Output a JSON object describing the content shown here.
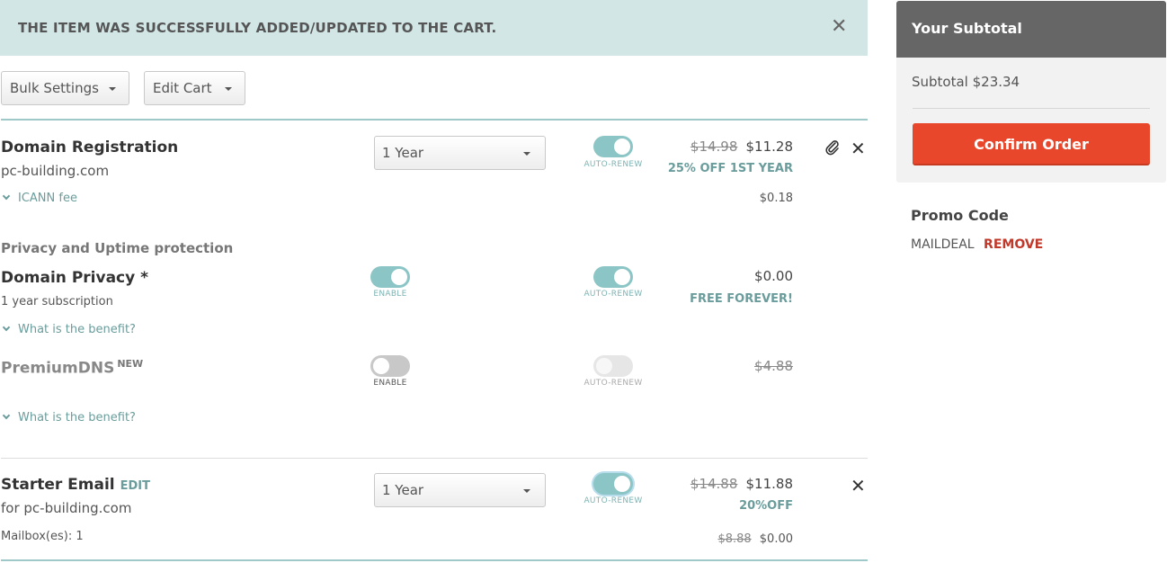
{
  "alert": {
    "message": "THE ITEM WAS SUCCESSFULLY ADDED/UPDATED TO THE CART.",
    "close": "✕"
  },
  "toolbar": {
    "bulk_settings": "Bulk Settings",
    "edit_cart": "Edit Cart"
  },
  "domain": {
    "title": "Domain Registration",
    "name": "pc-building.com",
    "period": "1 Year",
    "auto_renew": "AUTO-RENEW",
    "old_price": "$14.98",
    "price": "$11.28",
    "discount": "25% OFF 1ST YEAR",
    "icann_label": "ICANN fee",
    "icann_price": "$0.18"
  },
  "protection": {
    "heading": "Privacy and Uptime protection",
    "privacy": {
      "title": "Domain Privacy *",
      "subtitle": "1 year subscription",
      "enable": "ENABLE",
      "auto_renew": "AUTO-RENEW",
      "price": "$0.00",
      "note": "FREE FOREVER!",
      "benefit": "What is the benefit?"
    },
    "premiumdns": {
      "title": "PremiumDNS",
      "badge": "NEW",
      "enable": "ENABLE",
      "auto_renew": "AUTO-RENEW",
      "old_price": "$4.88",
      "benefit": "What is the benefit?"
    }
  },
  "email": {
    "title": "Starter Email",
    "edit": "EDIT",
    "for": "for pc-building.com",
    "period": "1 Year",
    "auto_renew": "AUTO-RENEW",
    "old_price": "$14.88",
    "price": "$11.88",
    "discount": "20%OFF",
    "mailboxes": "Mailbox(es): 1",
    "mailbox_old_price": "$8.88",
    "mailbox_price": "$0.00"
  },
  "sidebar": {
    "title": "Your Subtotal",
    "subtotal": "Subtotal $23.34",
    "confirm": "Confirm Order",
    "promo_heading": "Promo Code",
    "promo_code": "MAILDEAL",
    "remove": "REMOVE"
  },
  "colors": {
    "accent": "#e8472b",
    "teal": "#8cc5c5",
    "alert_bg": "#d2e6e6"
  }
}
